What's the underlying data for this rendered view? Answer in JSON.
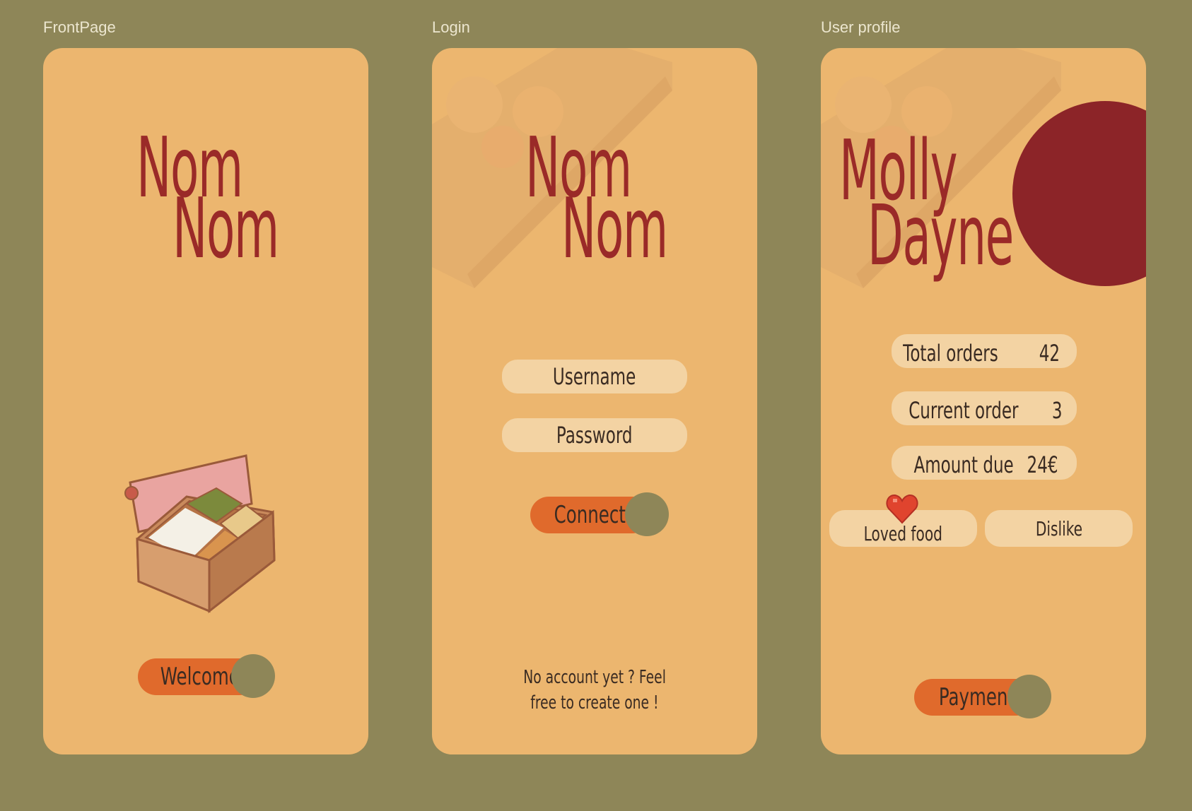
{
  "frames": {
    "front": {
      "label": "FrontPage"
    },
    "login": {
      "label": "Login"
    },
    "profile": {
      "label": "User profile"
    }
  },
  "front": {
    "logo_line1": "Nom",
    "logo_line2": "Nom",
    "welcome_button": "Welcome"
  },
  "login": {
    "logo_line1": "Nom",
    "logo_line2": "Nom",
    "username_placeholder": "Username",
    "password_placeholder": "Password",
    "connect_button": "Connect",
    "signup_line1": "No account yet ? Feel",
    "signup_line2": "free to create one !"
  },
  "profile": {
    "first_name": "Molly",
    "last_name": "Dayne",
    "stats": [
      {
        "label": "Total orders",
        "value": "42"
      },
      {
        "label": "Current order",
        "value": "3"
      },
      {
        "label": "Amount due",
        "value": "24€"
      }
    ],
    "loved_food": "Loved food",
    "dislike": "Dislike",
    "payment_button": "Payment"
  },
  "colors": {
    "background": "#8e8658",
    "card": "#ecb66f",
    "title": "#9a2a28",
    "field": "#f3d3a3",
    "button": "#e06a2c",
    "avatar": "#8c2428"
  },
  "icons": [
    "bento-box-icon",
    "heart-icon"
  ]
}
